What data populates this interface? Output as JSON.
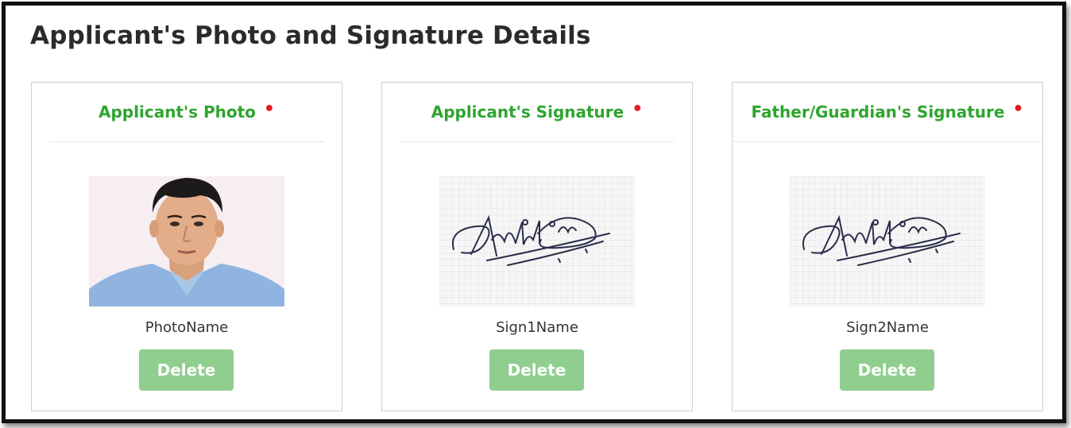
{
  "page": {
    "title": "Applicant's Photo and Signature Details"
  },
  "cards": [
    {
      "title": "Applicant's Photo",
      "required_mark": "•",
      "file_name": "PhotoName",
      "delete_label": "Delete",
      "media": "applicant-photo"
    },
    {
      "title": "Applicant's Signature",
      "required_mark": "•",
      "file_name": "Sign1Name",
      "delete_label": "Delete",
      "media": "signature-image"
    },
    {
      "title": "Father/Guardian's Signature",
      "required_mark": "•",
      "file_name": "Sign2Name",
      "delete_label": "Delete",
      "media": "signature-image"
    }
  ],
  "colors": {
    "title_green": "#2ea52e",
    "required_red": "#e51c23",
    "delete_button": "#8fce8f"
  }
}
